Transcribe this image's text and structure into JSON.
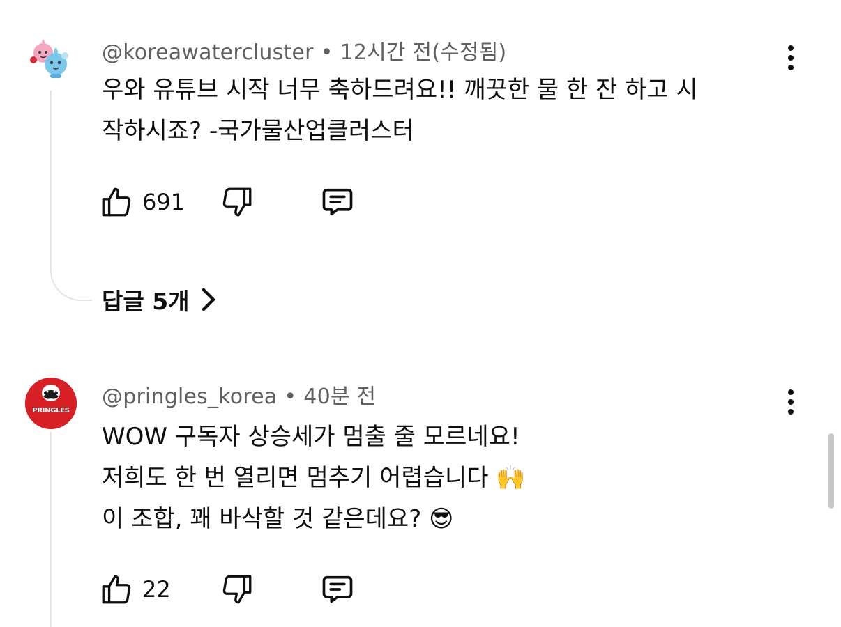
{
  "comments": [
    {
      "author": "@koreawatercluster",
      "separator": "•",
      "time": "12시간 전(수정됨)",
      "lines": [
        "우와 유튜브 시작 너무 축하드려요!! 깨끗한 물 한 잔 하고 시",
        "작하시죠? -국가물산업클러스터"
      ],
      "likes": "691",
      "replies_label": "답글 5개",
      "avatar_icon": "water-drop-characters-icon"
    },
    {
      "author": "@pringles_korea",
      "separator": "•",
      "time": "40분 전",
      "lines": [
        "WOW 구독자 상승세가 멈출 줄 모르네요!",
        "저희도 한 번 열리면 멈추기 어렵습니다 🙌",
        "이 조합, 꽤 바삭할 것 같은데요? 😎"
      ],
      "likes": "22",
      "avatar_text": "PRINGLES",
      "avatar_icon": "pringles-logo-icon"
    }
  ],
  "colors": {
    "text_primary": "#0f0f0f",
    "text_secondary": "#606060",
    "thread_line": "#e5e5e5",
    "pringles_red": "#d71f26"
  }
}
